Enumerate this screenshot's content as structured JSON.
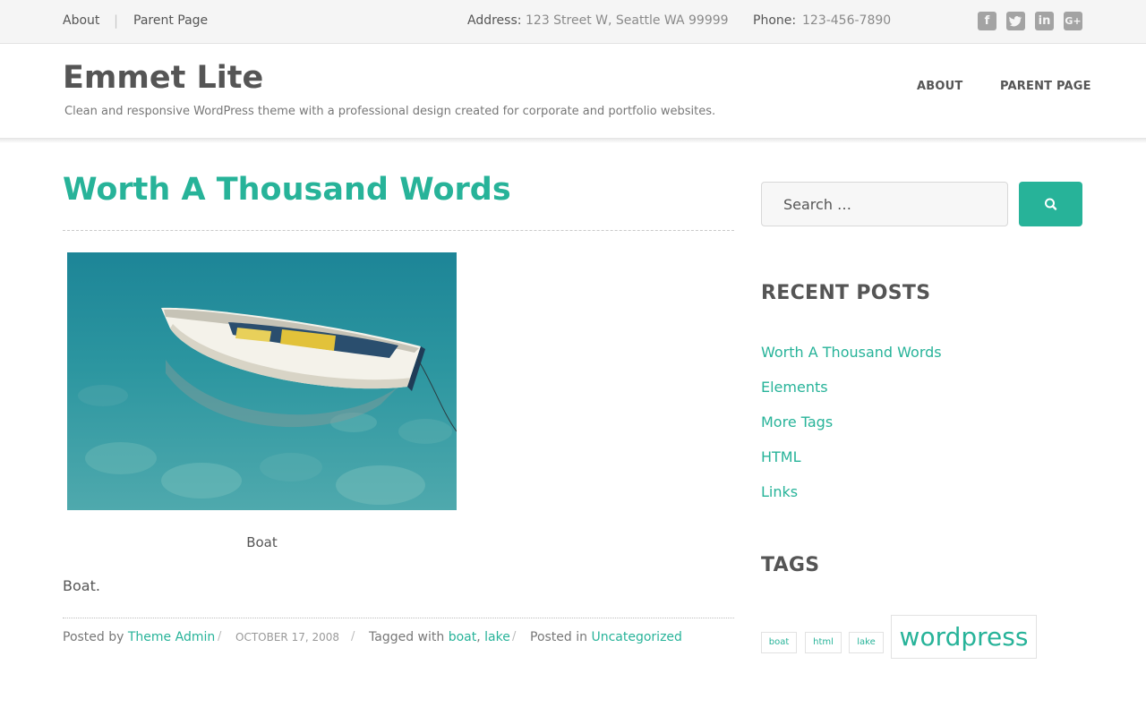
{
  "topbar": {
    "links": [
      "About",
      "Parent Page"
    ],
    "separator": "|",
    "address_label": "Address:",
    "address_value": "123 Street W, Seattle WA 99999",
    "phone_label": "Phone:",
    "phone_value": "123-456-7890",
    "social_icons": [
      "facebook-icon",
      "twitter-icon",
      "linkedin-icon",
      "google-plus-icon"
    ]
  },
  "header": {
    "site_title": "Emmet Lite",
    "tagline": "Clean and responsive WordPress theme with a professional design created for corporate and portfolio websites.",
    "nav": [
      "ABOUT",
      "PARENT PAGE"
    ]
  },
  "post": {
    "title": "Worth A Thousand Words",
    "image_caption": "Boat",
    "body": "Boat.",
    "meta": {
      "posted_by_label": "Posted by",
      "author": "Theme Admin",
      "date": "OCTOBER 17, 2008",
      "tagged_label": "Tagged with",
      "tags": [
        "boat",
        "lake"
      ],
      "tag_comma": ",",
      "posted_in_label": "Posted in",
      "category": "Uncategorized",
      "separator": "/"
    }
  },
  "sidebar": {
    "search_placeholder": "Search …",
    "recent_posts_title": "RECENT POSTS",
    "recent_posts": [
      "Worth A Thousand Words",
      "Elements",
      "More Tags",
      "HTML",
      "Links"
    ],
    "tags_title": "TAGS",
    "tag_cloud": [
      "boat",
      "html",
      "lake",
      "wordpress"
    ]
  },
  "colors": {
    "accent": "#27b399",
    "text": "#555555",
    "topbar_bg": "#f5f5f5",
    "social_icon": "#a3a3a3"
  }
}
